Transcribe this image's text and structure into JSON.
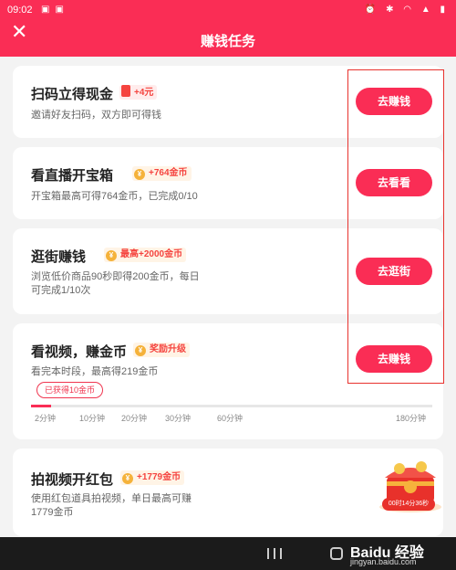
{
  "status_bar": {
    "time": "09:02"
  },
  "header": {
    "title": "赚钱任务",
    "close_icon": "close-icon"
  },
  "tasks": [
    {
      "name": "扫码立得现金",
      "reward_icon": "red-packet-icon",
      "reward": "+4元",
      "desc": "邀请好友扫码，双方即可得钱",
      "button": "去赚钱"
    },
    {
      "name": "看直播开宝箱",
      "reward_icon": "coin-icon",
      "reward": "+764金币",
      "desc": "开宝箱最高可得764金币，已完成0/10",
      "button": "去看看"
    },
    {
      "name": "逛街赚钱",
      "reward_icon": "coin-icon",
      "reward": "最高+2000金币",
      "desc_line1": "浏览低价商品90秒即得200金币，每日",
      "desc_line2": "可完成1/10次",
      "button": "去逛街"
    },
    {
      "name": "看视频，赚金币",
      "reward_icon": "coin-icon",
      "reward": "奖励升级",
      "desc": "看完本时段，最高得219金币",
      "button": "去赚钱",
      "progress": {
        "label": "已获得10金币",
        "value_minutes": 2,
        "max_minutes": 180,
        "ticks": [
          "2分钟",
          "10分钟",
          "20分钟",
          "30分钟",
          "60分钟",
          "180分钟"
        ]
      }
    },
    {
      "name": "拍视频开红包",
      "reward_icon": "coin-icon",
      "reward": "+1779金币",
      "desc_line1": "使用红包道具拍视频，单日最高可赚",
      "desc_line2": "1779金币",
      "countdown": "00时14分36秒"
    }
  ],
  "watermark": {
    "brand": "Baidu 经验",
    "url": "jingyan.baidu.com"
  },
  "colors": {
    "accent": "#fa2d55",
    "highlight_box": "#e8322e",
    "reward_text": "#f5443f"
  }
}
